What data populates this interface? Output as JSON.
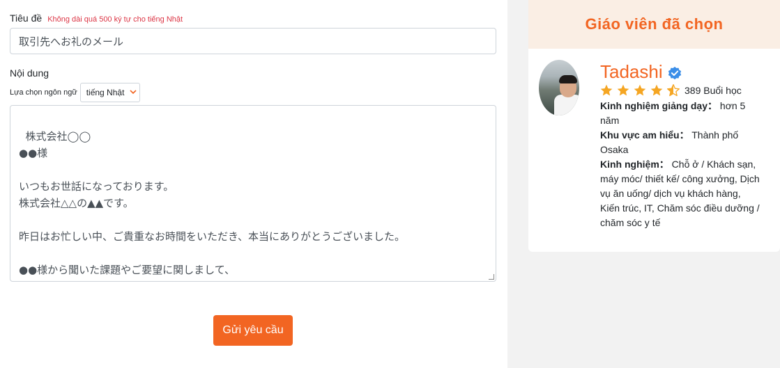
{
  "form": {
    "title_label": "Tiêu đề",
    "title_hint": "Không dài quá 500 ký tự cho tiếng Nhật",
    "title_value": "取引先へお礼のメール",
    "content_label": "Nội dung",
    "lang_label": "Lựa chọn ngôn ngữ",
    "lang_value": "tiếng Nhật",
    "content_value": "株式会社◯◯\n●●様\n\nいつもお世話になっております。\n株式会社△△の▲▲です。\n\n昨日はお忙しい中、ご貴重なお時間をいただき、本当にありがとうございました。\n\n●●様から聞いた課題やご要望に関しまして、\n貴社で新たな対策を検討しつつ、次の提案をしたいと思います。",
    "submit_label": "Gửi yêu cầu"
  },
  "teacher_card": {
    "header": "Giáo viên đã chọn",
    "name": "Tadashi",
    "rating": 4.5,
    "sessions": "389 Buổi học",
    "experience_label": "Kinh nghiệm giảng dạy：",
    "experience_value": " hơn 5 năm",
    "area_label": "Khu vực am hiểu：",
    "area_value": " Thành phố Osaka",
    "field_label": "Kinh nghiệm：",
    "field_value": " Chỗ ở / Khách sạn, máy móc/ thiết kế/ công xưởng, Dịch vụ ăn uống/ dịch vụ khách hàng, Kiến trúc, IT, Chăm sóc điều dưỡng / chăm sóc y tế"
  },
  "colors": {
    "accent": "#f26522",
    "star": "#f5a623",
    "verified": "#3b8ee8",
    "hint": "#dc3545"
  },
  "icons": {
    "verified": "verified-check-icon",
    "star": "star-icon",
    "dropdown": "chevron-down-icon"
  }
}
